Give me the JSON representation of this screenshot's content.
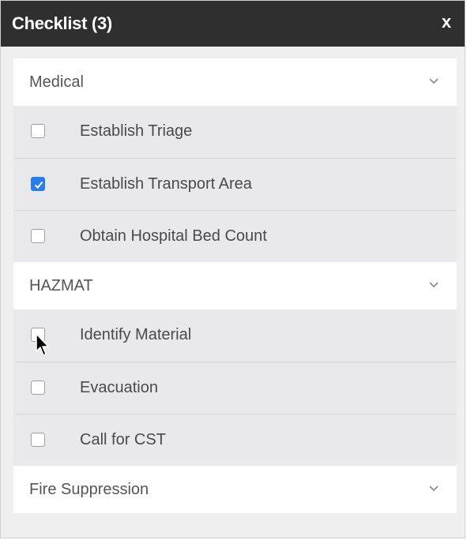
{
  "window": {
    "title": "Checklist (3)",
    "close_label": "x"
  },
  "sections": [
    {
      "label": "Medical",
      "expanded": true,
      "items": [
        {
          "label": "Establish Triage",
          "checked": false
        },
        {
          "label": "Establish Transport Area",
          "checked": true
        },
        {
          "label": "Obtain Hospital Bed Count",
          "checked": false
        }
      ]
    },
    {
      "label": "HAZMAT",
      "expanded": true,
      "items": [
        {
          "label": "Identify Material",
          "checked": false
        },
        {
          "label": "Evacuation",
          "checked": false
        },
        {
          "label": "Call for CST",
          "checked": false
        }
      ]
    },
    {
      "label": "Fire Suppression",
      "expanded": false,
      "items": []
    }
  ],
  "colors": {
    "titlebar": "#2f2f2f",
    "checkbox_checked": "#2b7de9"
  },
  "icons": {
    "section_toggle": "chevron-down-icon",
    "checked_mark": "checkmark-icon",
    "pointer": "mouse-cursor-icon"
  }
}
